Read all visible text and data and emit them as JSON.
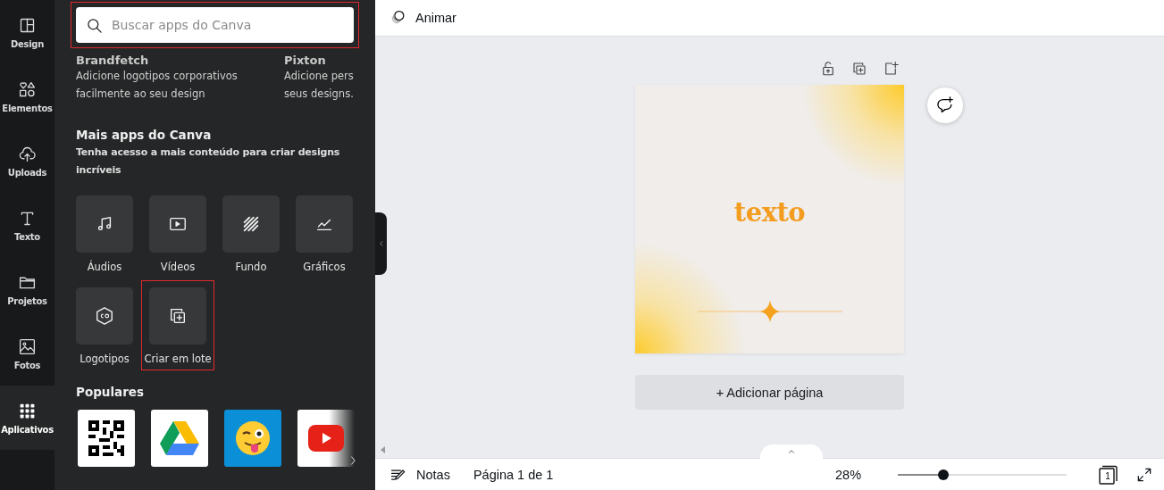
{
  "nav": [
    {
      "label": "Design",
      "kind": "layout",
      "selected": false
    },
    {
      "label": "Elementos",
      "kind": "shapes",
      "selected": false
    },
    {
      "label": "Uploads",
      "kind": "cloud",
      "selected": false
    },
    {
      "label": "Texto",
      "kind": "text",
      "selected": false
    },
    {
      "label": "Projetos",
      "kind": "folder",
      "selected": false
    },
    {
      "label": "Fotos",
      "kind": "image",
      "selected": false
    },
    {
      "label": "Aplicativos",
      "kind": "grid",
      "selected": true
    }
  ],
  "search": {
    "placeholder": "Buscar apps do Canva",
    "highlighted": true
  },
  "featured": [
    {
      "name": "Brandfetch",
      "description": [
        "Adicione logotipos corporativos",
        "facilmente ao seu design"
      ]
    },
    {
      "name": "Pixton",
      "description": [
        "Adicione pers",
        "seus designs."
      ]
    }
  ],
  "more_apps": {
    "title": "Mais apps do Canva",
    "subtitle": "Tenha acesso a mais conteúdo para criar designs incríveis",
    "tiles": [
      {
        "label": "Áudios",
        "kind": "music",
        "highlighted": false
      },
      {
        "label": "Vídeos",
        "kind": "video",
        "highlighted": false
      },
      {
        "label": "Fundo",
        "kind": "stripes",
        "highlighted": false
      },
      {
        "label": "Gráficos",
        "kind": "chart",
        "highlighted": false
      },
      {
        "label": "Logotipos",
        "kind": "logo",
        "highlighted": false
      },
      {
        "label": "Criar em lote",
        "kind": "batch",
        "highlighted": true
      }
    ]
  },
  "popular": {
    "title": "Populares",
    "apps": [
      {
        "kind": "qr"
      },
      {
        "kind": "drive"
      },
      {
        "kind": "emoji"
      },
      {
        "kind": "youtube"
      }
    ]
  },
  "toolbar": {
    "animate": "Animar"
  },
  "design": {
    "text": "texto"
  },
  "add_page": "+ Adicionar página",
  "footer": {
    "notes": "Notas",
    "page_info": "Página 1 de 1",
    "zoom": "28%",
    "zoom_slider": {
      "level": 0.27
    },
    "page_count": "1"
  }
}
